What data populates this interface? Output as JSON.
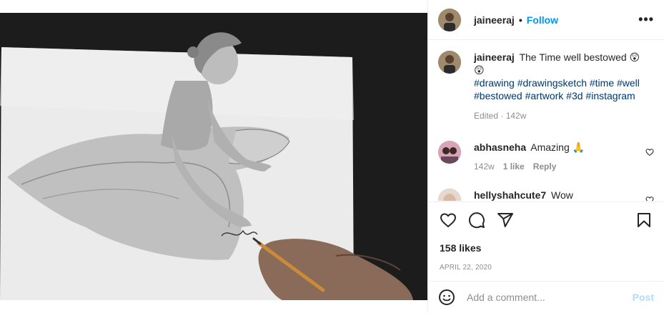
{
  "header": {
    "username": "jaineeraj",
    "separator": "•",
    "follow_label": "Follow",
    "more_label": "•••"
  },
  "caption": {
    "username": "jaineeraj",
    "text": "The Time well bestowed 😲😲",
    "hashtags": "#drawing #drawingsketch #time #well #bestowed #artwork #3d #instagram",
    "meta": "Edited · 142w"
  },
  "comments": [
    {
      "username": "abhasneha",
      "text": "Amazing 🙏",
      "age": "142w",
      "likes": "1 like",
      "reply": "Reply"
    },
    {
      "username": "hellyshahcute7",
      "text": "Wow"
    }
  ],
  "likes": "158 likes",
  "date": "APRIL 22, 2020",
  "add_comment": {
    "placeholder": "Add a comment...",
    "post_label": "Post"
  },
  "icons": {
    "heart": "heart-icon",
    "comment": "comment-icon",
    "share": "paper-plane-icon",
    "save": "bookmark-icon",
    "emoji": "smiley-icon"
  },
  "colors": {
    "link": "#0095f6",
    "hashtag": "#00376b",
    "muted": "#8e8e8e",
    "post_disabled": "#b3dbff"
  }
}
